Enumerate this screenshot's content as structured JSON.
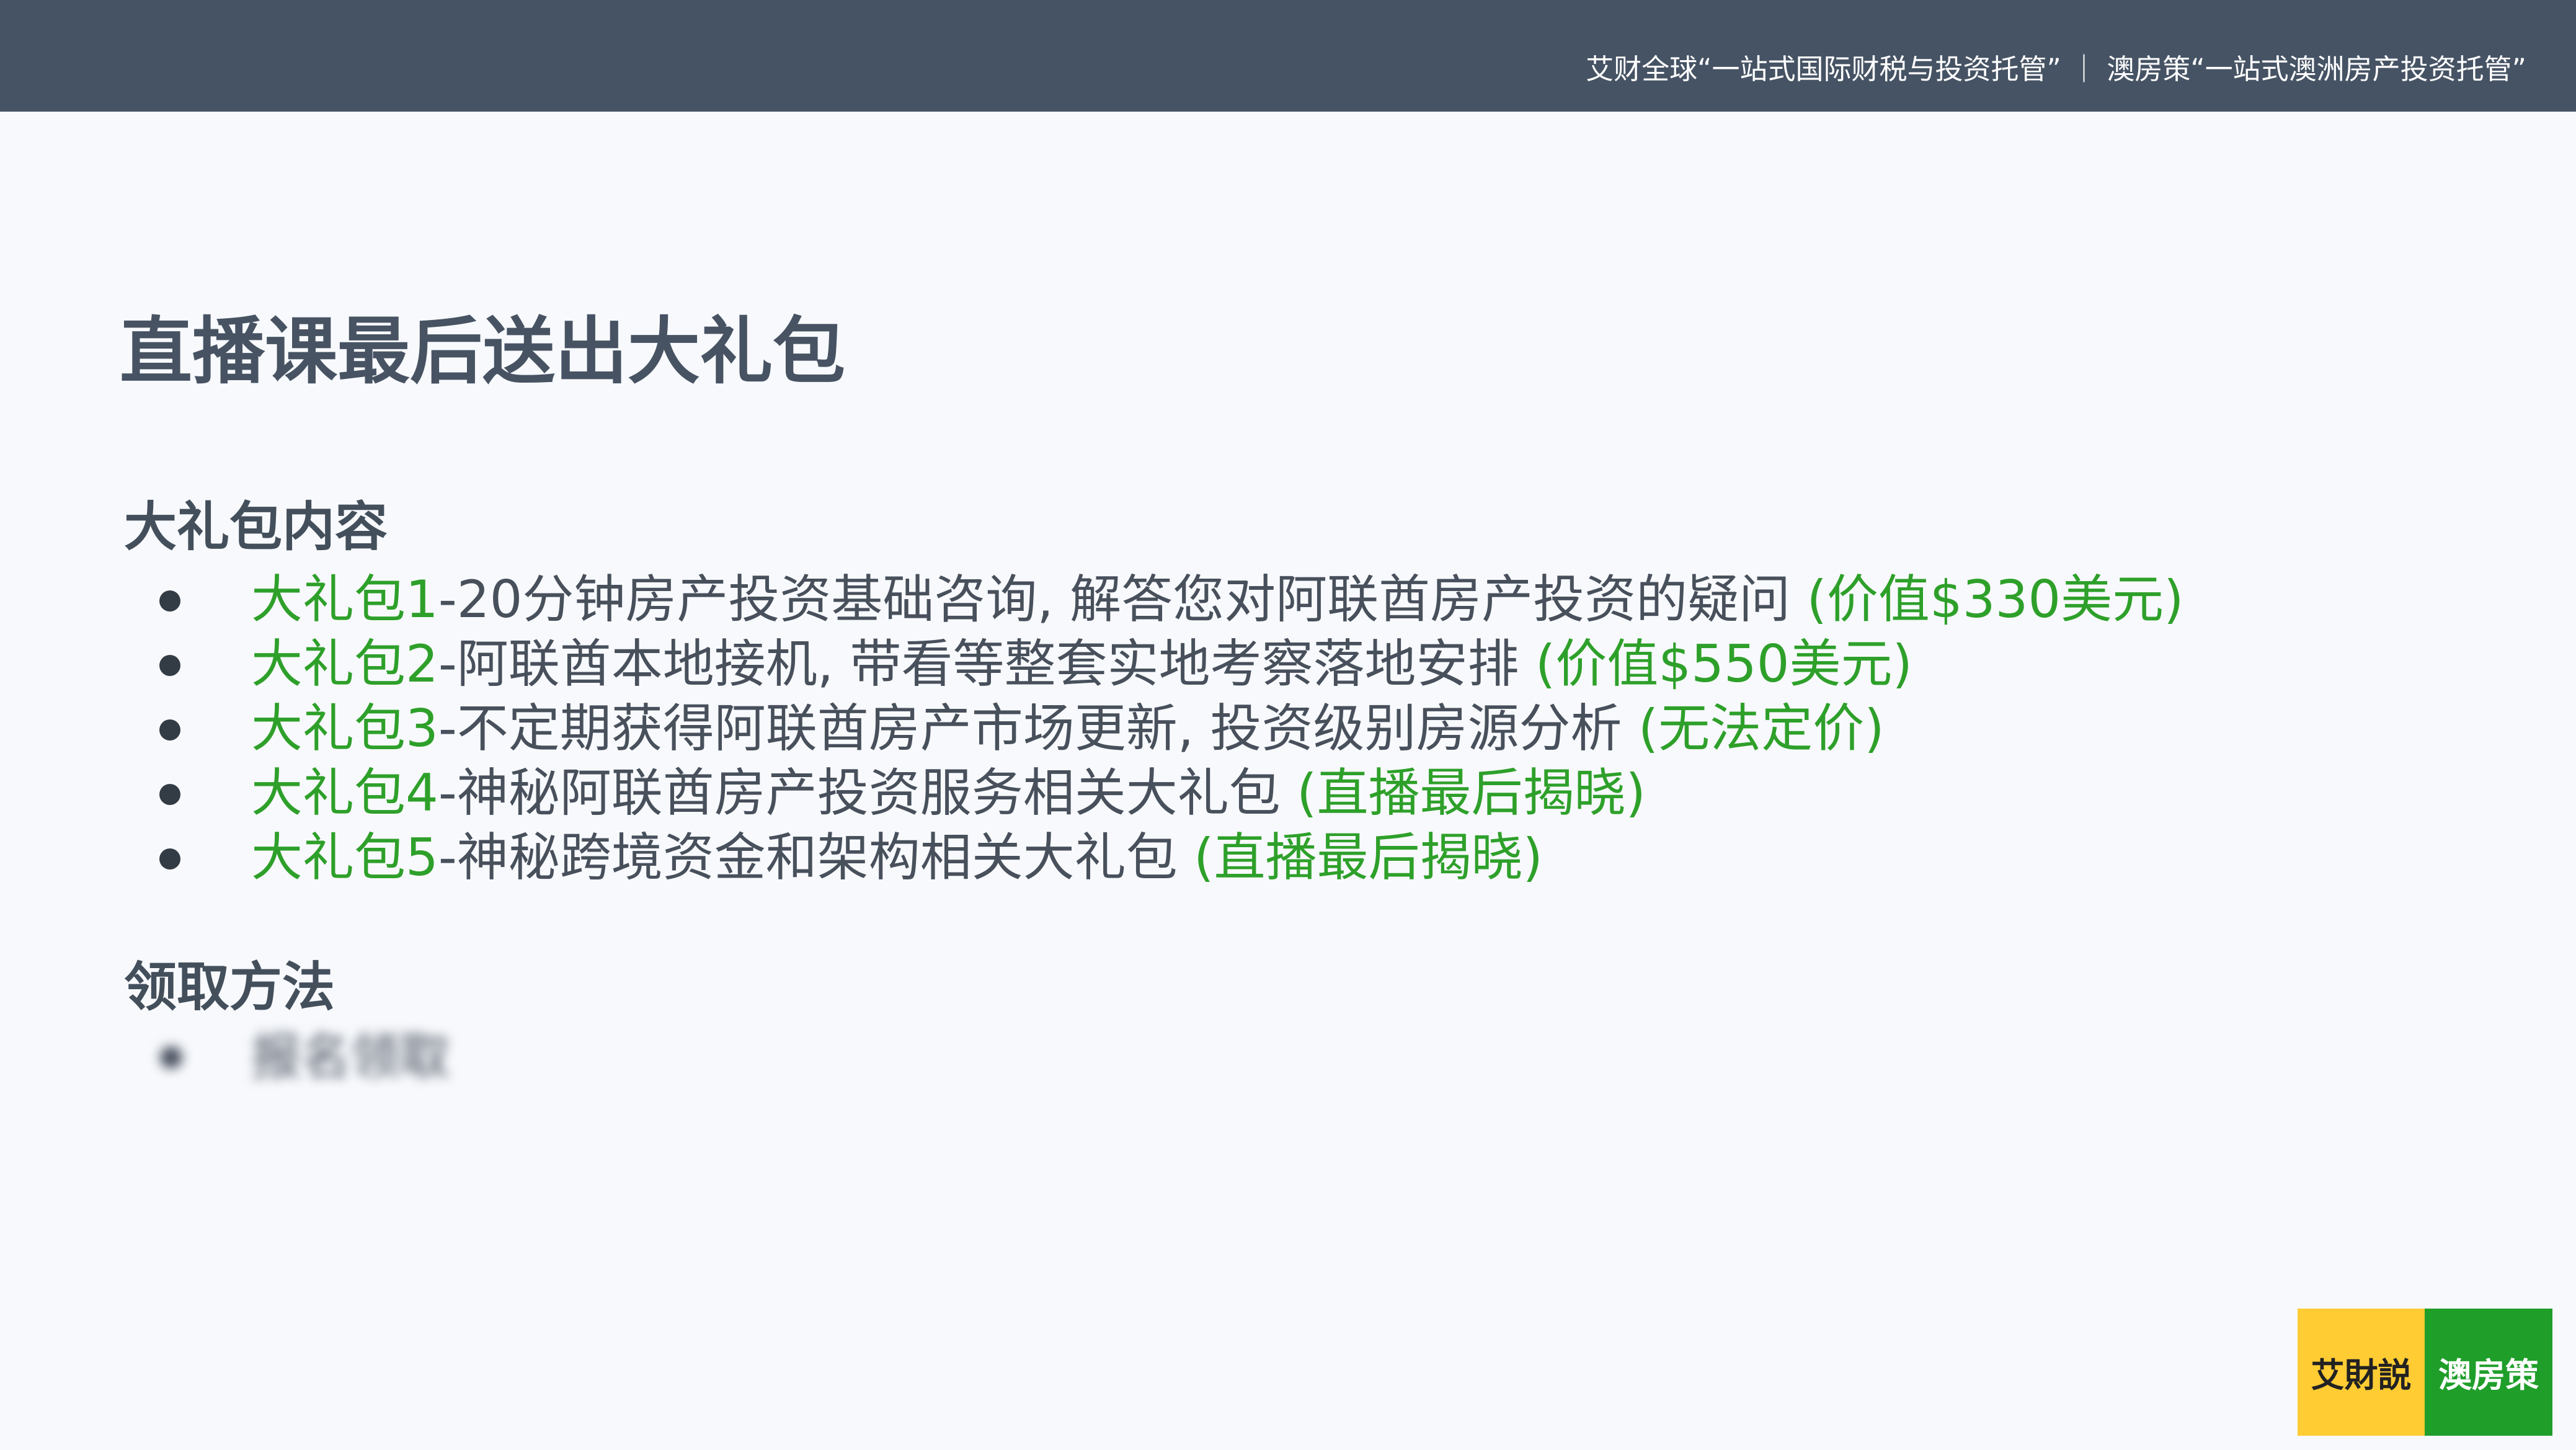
{
  "header": {
    "tagline": "艾财全球“一站式国际财税与投资托管” ｜ 澳房策“一站式澳洲房产投资托管”"
  },
  "page": {
    "title": "直播课最后送出大礼包"
  },
  "sections": {
    "content_heading": "大礼包内容",
    "method_heading": "领取方法"
  },
  "gifts": [
    {
      "name": "大礼包1",
      "desc": "-20分钟房产投资基础咨询, 解答您对阿联酋房产投资的疑问 ",
      "value": "(价值$330美元)"
    },
    {
      "name": "大礼包2",
      "desc": "-阿联酋本地接机, 带看等整套实地考察落地安排 ",
      "value": "(价值$550美元)"
    },
    {
      "name": "大礼包3",
      "desc": "-不定期获得阿联酋房产市场更新, 投资级别房源分析 ",
      "value": "(无法定价)"
    },
    {
      "name": "大礼包4",
      "desc": "-神秘阿联酋房产投资服务相关大礼包 ",
      "value": "(直播最后揭晓)"
    },
    {
      "name": "大礼包5",
      "desc": "-神秘跨境资金和架构相关大礼包 ",
      "value": "(直播最后揭晓)"
    }
  ],
  "method": {
    "hidden_text": "报名领取"
  },
  "logo": {
    "left_text": "艾財説",
    "right_text": "澳房策"
  },
  "colors": {
    "header_bg": "#465364",
    "accent_green": "#2ea02a",
    "logo_yellow": "#ffcc33",
    "logo_green": "#1f9e2a"
  }
}
